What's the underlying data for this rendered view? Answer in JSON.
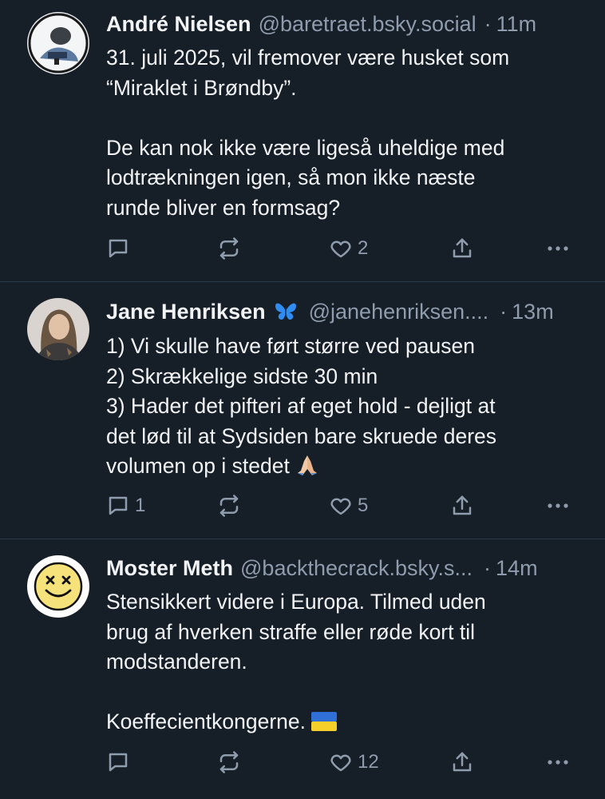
{
  "posts": [
    {
      "author": "André Nielsen",
      "handle": "@baretraet.bsky.social",
      "separator": "·",
      "time": "11m",
      "text_lines": [
        "31. juli 2025, vil fremover være husket som",
        "“Miraklet i Brøndby”.",
        "",
        "De kan nok ikke være ligeså uheldige med",
        "lodtrækningen igen, så mon ikke næste",
        "runde bliver en formsag?"
      ],
      "reply_count": "",
      "repost_count": "",
      "like_count": "2"
    },
    {
      "author": "Jane Henriksen",
      "author_badge": "butterfly-emoji",
      "handle": "@janehenriksen....",
      "separator": "·",
      "time": "13m",
      "text_lines": [
        "1) Vi skulle have ført større ved pausen",
        "2) Skrækkelige sidste 30 min",
        "3) Hader det pifteri af eget hold - dejligt at",
        "det lød til at Sydsiden bare skruede deres",
        "volumen op i stedet"
      ],
      "trailing_emoji": "praying-hands-emoji",
      "reply_count": "1",
      "repost_count": "",
      "like_count": "5"
    },
    {
      "author": "Moster Meth",
      "handle": "@backthecrack.bsky.s...",
      "separator": "·",
      "time": "14m",
      "text_lines": [
        "Stensikkert videre i Europa. Tilmed uden",
        "brug af hverken straffe eller røde kort til",
        "modstanderen.",
        "",
        "Koeffecientkongerne."
      ],
      "trailing_emoji": "ukraine-flag-emoji",
      "reply_count": "",
      "repost_count": "",
      "like_count": "12"
    }
  ],
  "colors": {
    "background": "#161e27",
    "text": "#f1f3f5",
    "muted": "#8e9cad",
    "divider": "#2c3a4b"
  }
}
